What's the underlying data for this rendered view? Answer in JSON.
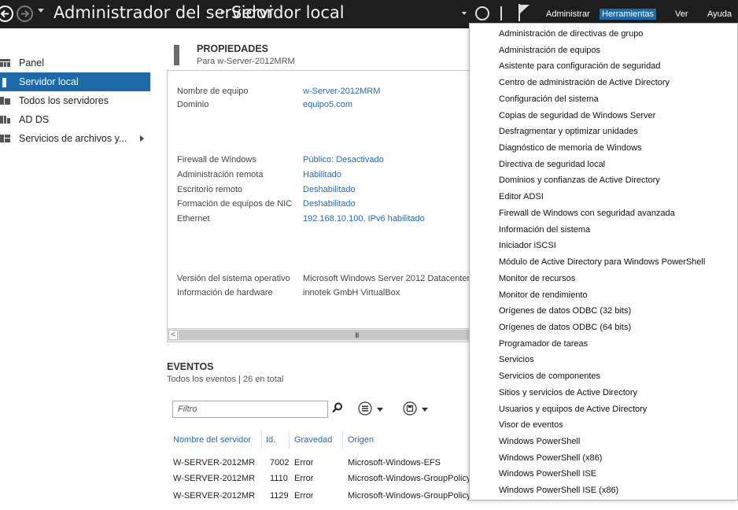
{
  "titlebar": {
    "app_title": "Administrador del servidor",
    "page_title": "Servidor local",
    "menu": {
      "administrar": "Administrar",
      "herramientas": "Herramientas",
      "ver": "Ver",
      "ayuda": "Ayuda"
    }
  },
  "sidebar": {
    "items": [
      {
        "label": "Panel",
        "icon": "dashboard-icon"
      },
      {
        "label": "Servidor local",
        "icon": "server-icon",
        "active": true
      },
      {
        "label": "Todos los servidores",
        "icon": "servers-icon"
      },
      {
        "label": "AD DS",
        "icon": "adds-icon"
      },
      {
        "label": "Servicios de archivos y...",
        "icon": "file-services-icon",
        "has_submenu": true
      }
    ]
  },
  "properties": {
    "title": "PROPIEDADES",
    "subtitle": "Para w-Server-2012MRM",
    "rows": [
      {
        "label": "Nombre de equipo",
        "value": "w-Server-2012MRM"
      },
      {
        "label": "Dominio",
        "value": "equipo5.com"
      },
      {
        "label": "Firewall de Windows",
        "value": "Público: Desactivado"
      },
      {
        "label": "Administración remota",
        "value": "Habilitado"
      },
      {
        "label": "Escritorio remoto",
        "value": "Deshabilitado"
      },
      {
        "label": "Formación de equipos de NIC",
        "value": "Deshabilitado"
      },
      {
        "label": "Ethernet",
        "value": "192.168.10.100, IPv6 habilitado"
      },
      {
        "label": "Versión del sistema operativo",
        "value": "Microsoft Windows Server 2012 Datacenter"
      },
      {
        "label": "Información de hardware",
        "value": "innotek GmbH VirtualBox"
      }
    ],
    "scroll_left": "<",
    "scroll_grip": "III"
  },
  "events": {
    "title": "EVENTOS",
    "subtitle": "Todos los eventos | 26 en total",
    "filter_placeholder": "Filtro",
    "columns": [
      "Nombre del servidor",
      "Id.",
      "Gravedad",
      "Origen"
    ],
    "rows": [
      [
        "W-SERVER-2012MR",
        "7002",
        "Error",
        "Microsoft-Windows-EFS"
      ],
      [
        "W-SERVER-2012MR",
        "1110",
        "Error",
        "Microsoft-Windows-GroupPolicy"
      ],
      [
        "W-SERVER-2012MR",
        "1129",
        "Error",
        "Microsoft-Windows-GroupPolicy"
      ]
    ]
  },
  "tools_menu": {
    "items": [
      "Administración de directivas de grupo",
      "Administración de equipos",
      "Asistente para configuración de seguridad",
      "Centro de administración de Active Directory",
      "Configuración del sistema",
      "Copias de seguridad de Windows Server",
      "Desfragmentar y optimizar unidades",
      "Diagnóstico de memoria de Windows",
      "Directiva de seguridad local",
      "Dominios y confianzas de Active Directory",
      "Editor ADSI",
      "Firewall de Windows con seguridad avanzada",
      "Información del sistema",
      "Iniciador iSCSI",
      "Módulo de Active Directory para Windows PowerShell",
      "Monitor de recursos",
      "Monitor de rendimiento",
      "Orígenes de datos ODBC (32 bits)",
      "Orígenes de datos ODBC (64 bits)",
      "Programador de tareas",
      "Servicios",
      "Servicios de componentes",
      "Sitios y servicios de Active Directory",
      "Usuarios y equipos de Active Directory",
      "Visor de eventos",
      "Windows PowerShell",
      "Windows PowerShell (x86)",
      "Windows PowerShell ISE",
      "Windows PowerShell ISE (x86)"
    ]
  },
  "colors": {
    "titlebar_bg": "#1e1e1e",
    "accent": "#1c6aa8",
    "link": "#2a6aae"
  }
}
